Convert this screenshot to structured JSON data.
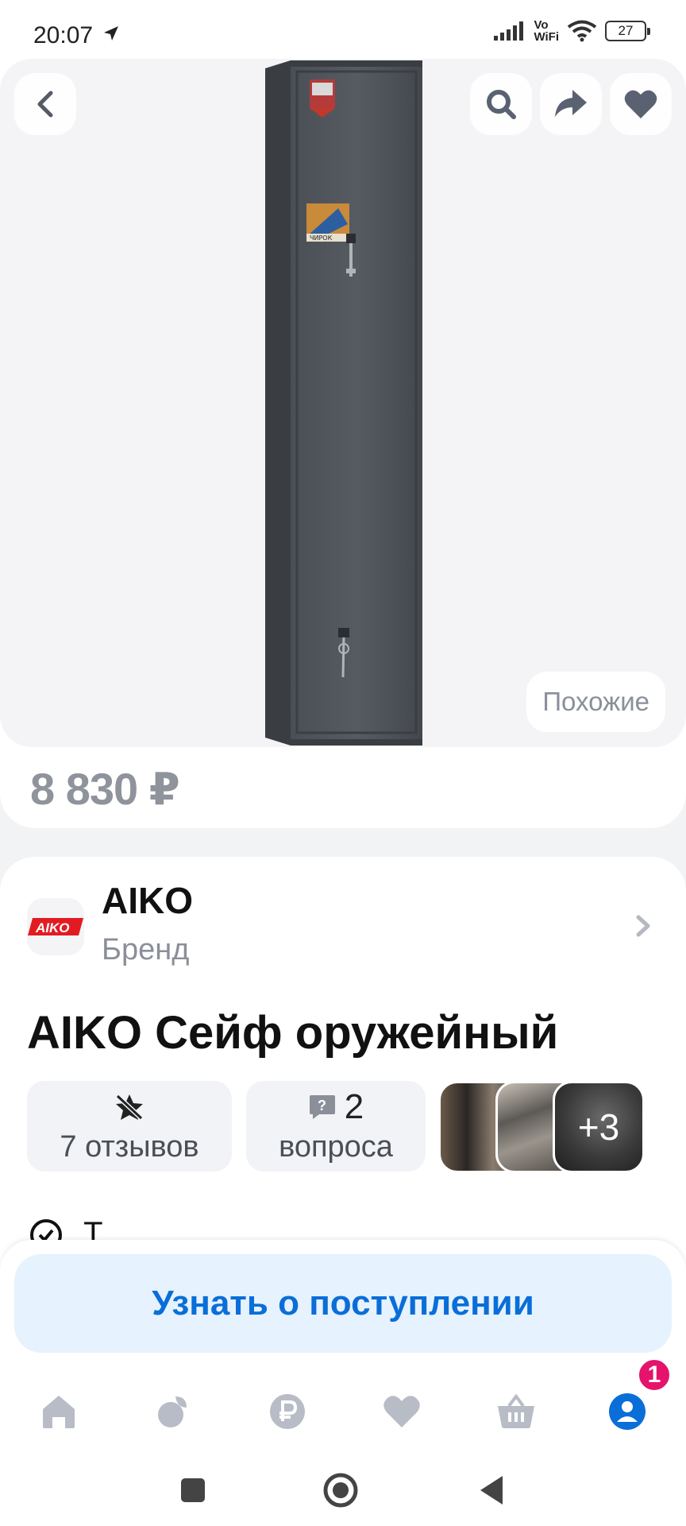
{
  "status_bar": {
    "time": "20:07",
    "network_label_top": "Vo",
    "network_label_bottom": "WiFi",
    "battery": "27"
  },
  "product": {
    "similar_label": "Похожие",
    "price": "8 830 ₽",
    "image_sticker_text": "ЧИРОК"
  },
  "brand": {
    "logo_text": "AIKO",
    "name": "AIKO",
    "subtitle": "Бренд"
  },
  "title": "AIKO Сейф оружейный",
  "chips": {
    "reviews_label": "7 отзывов",
    "questions_count": "2",
    "questions_label": "вопроса"
  },
  "photos": {
    "more_label": "+3"
  },
  "delivery_peek": "Т",
  "action": {
    "notify_label": "Узнать о поступлении"
  },
  "bottom_nav": {
    "items": [
      "home-icon",
      "catalog-icon",
      "ruble-icon",
      "favorites-icon",
      "basket-icon",
      "profile-icon"
    ],
    "profile_badge": "1",
    "active_color": "#0a6ed8",
    "inactive_color": "#b8bcc6"
  },
  "colors": {
    "accent": "#0a6ed8",
    "badge": "#e5136b",
    "price": "#8f939c"
  }
}
